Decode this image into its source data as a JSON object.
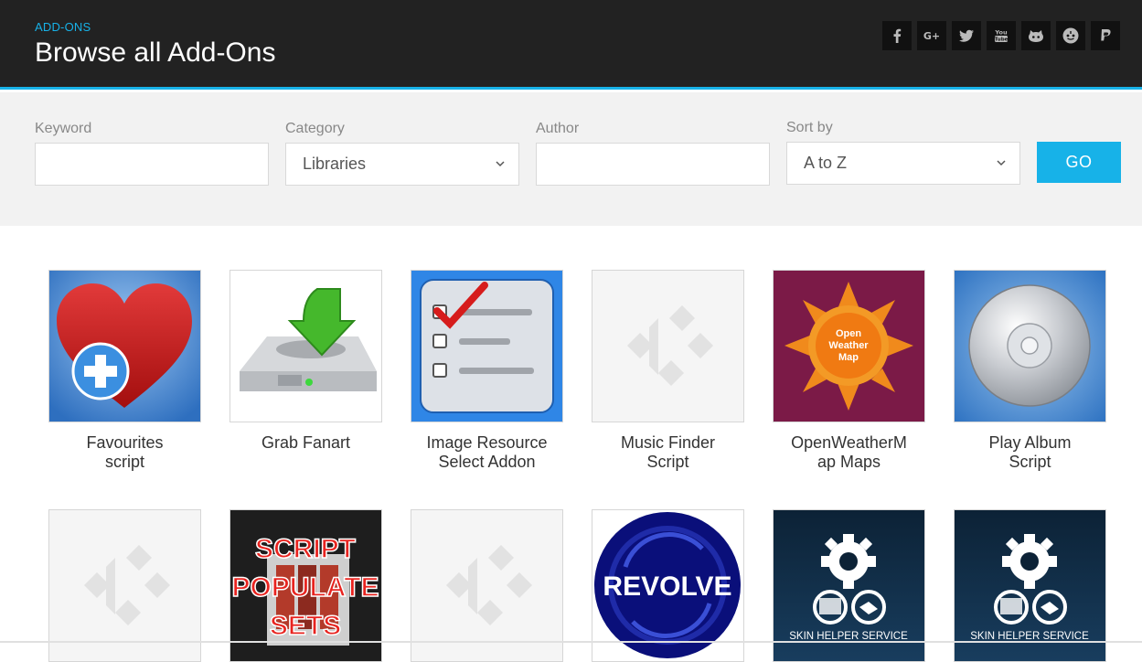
{
  "header": {
    "section_label": "ADD-ONS",
    "title": "Browse all Add-Ons",
    "social": [
      {
        "name": "facebook-icon",
        "glyph": "f"
      },
      {
        "name": "google-plus-icon",
        "glyph": "G+"
      },
      {
        "name": "twitter-icon",
        "glyph": "t"
      },
      {
        "name": "youtube-icon",
        "glyph": "You Tube"
      },
      {
        "name": "github-icon",
        "glyph": "gh"
      },
      {
        "name": "reddit-icon",
        "glyph": "r"
      },
      {
        "name": "paypal-icon",
        "glyph": "P"
      }
    ]
  },
  "filters": {
    "keyword": {
      "label": "Keyword",
      "value": ""
    },
    "category": {
      "label": "Category",
      "value": "Libraries"
    },
    "author": {
      "label": "Author",
      "value": ""
    },
    "sort": {
      "label": "Sort by",
      "value": "A to Z"
    },
    "go_label": "GO"
  },
  "addons": [
    {
      "name": "Favourites script",
      "line1": "Favourites",
      "line2": "script",
      "icon": "heart-plus-icon"
    },
    {
      "name": "Grab Fanart",
      "line1": "Grab Fanart",
      "line2": "",
      "icon": "hdd-download-icon"
    },
    {
      "name": "Image Resource Select Addon",
      "line1": "Image Resource",
      "line2": "Select Addon",
      "icon": "checklist-icon"
    },
    {
      "name": "Music Finder Script",
      "line1": "Music Finder",
      "line2": "Script",
      "icon": "kodi-placeholder-icon"
    },
    {
      "name": "OpenWeatherMap Maps",
      "line1": "OpenWeatherM",
      "line2": "ap Maps",
      "icon": "sun-icon",
      "badge_lines": [
        "Open",
        "Weather",
        "Map"
      ]
    },
    {
      "name": "Play Album Script",
      "line1": "Play Album",
      "line2": "Script",
      "icon": "cd-icon"
    },
    {
      "name": "",
      "line1": "",
      "line2": "",
      "icon": "kodi-placeholder-icon"
    },
    {
      "name": "",
      "line1": "",
      "line2": "",
      "icon": "script-populate-sets-icon",
      "badge_lines": [
        "SCRIPT",
        "POPULATE",
        "SETS"
      ]
    },
    {
      "name": "",
      "line1": "",
      "line2": "",
      "icon": "kodi-placeholder-icon"
    },
    {
      "name": "",
      "line1": "",
      "line2": "",
      "icon": "revolve-icon",
      "badge_lines": [
        "REVOLVE"
      ]
    },
    {
      "name": "",
      "line1": "",
      "line2": "",
      "icon": "skin-helper-icon",
      "badge_lines": [
        "SKIN HELPER SERVICE"
      ]
    },
    {
      "name": "",
      "line1": "",
      "line2": "",
      "icon": "skin-helper-icon",
      "badge_lines": [
        "SKIN HELPER SERVICE"
      ]
    }
  ],
  "colors": {
    "accent": "#17b2e8",
    "header_bg": "#222222",
    "filter_bg": "#f2f2f2"
  }
}
